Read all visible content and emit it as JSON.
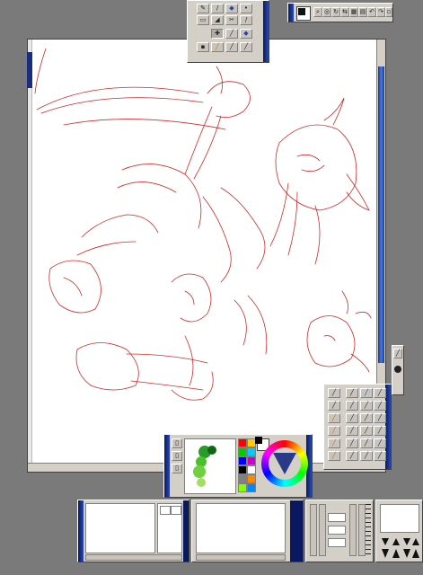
{
  "tool_panel_top": {
    "tools": [
      "pen-icon",
      "pencil-icon",
      "brush-icon",
      "airbrush-icon",
      "eraser-icon",
      "bucket-icon",
      "select-icon",
      "eyedropper-icon"
    ]
  },
  "top_toolbar": {
    "icons": [
      "zoom-icon",
      "hand-icon",
      "rotate-icon",
      "flip-icon",
      "grid-icon",
      "ruler-icon",
      "undo-icon",
      "redo-icon",
      "window-icon"
    ]
  },
  "canvas": {
    "background": "#ffffff",
    "stroke_color": "#cc2a2a"
  },
  "color_panel": {
    "swatches": [
      "#ff0000",
      "#ffcc00",
      "#00cc00",
      "#00ccff",
      "#0000ff",
      "#cc00cc",
      "#000000",
      "#ffffff",
      "#808080",
      "#ff8800",
      "#88ff00",
      "#0088ff"
    ],
    "current_color": "#000000",
    "secondary_color": "#ffffff"
  },
  "layer_panel_left": {
    "rows": [
      "",
      "",
      "",
      "",
      ""
    ]
  },
  "layer_panel_right": {
    "rows": [
      "",
      "",
      "",
      "",
      ""
    ]
  },
  "brush_presets": {
    "rows": 7
  },
  "window": {
    "accent": "#0a1860"
  }
}
